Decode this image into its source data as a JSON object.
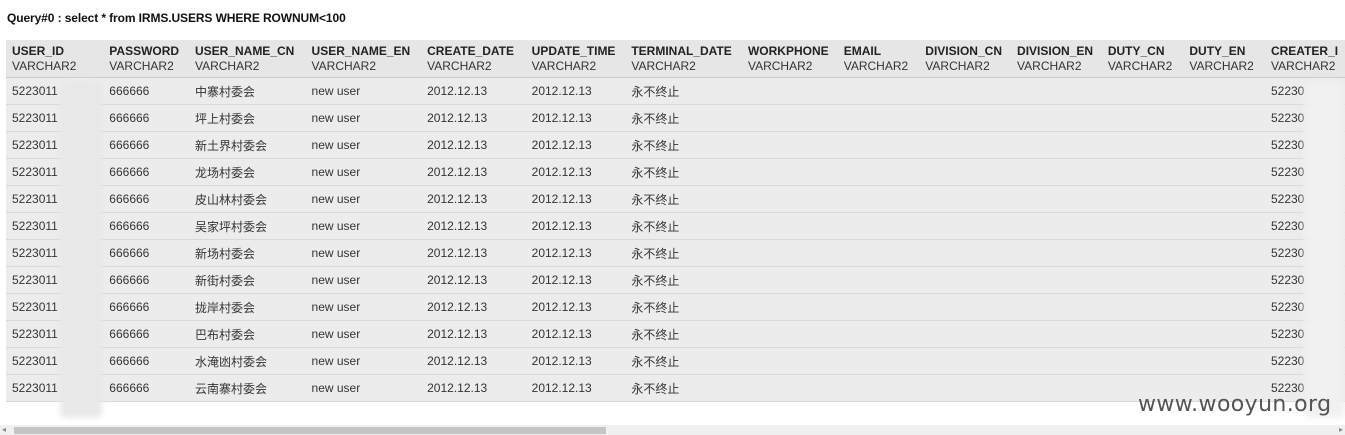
{
  "query": {
    "title": "Query#0 : select * from IRMS.USERS WHERE ROWNUM<100"
  },
  "columns": [
    {
      "name": "USER_ID",
      "type": "VARCHAR2"
    },
    {
      "name": "PASSWORD",
      "type": "VARCHAR2"
    },
    {
      "name": "USER_NAME_CN",
      "type": "VARCHAR2"
    },
    {
      "name": "USER_NAME_EN",
      "type": "VARCHAR2"
    },
    {
      "name": "CREATE_DATE",
      "type": "VARCHAR2"
    },
    {
      "name": "UPDATE_TIME",
      "type": "VARCHAR2"
    },
    {
      "name": "TERMINAL_DATE",
      "type": "VARCHAR2"
    },
    {
      "name": "WORKPHONE",
      "type": "VARCHAR2"
    },
    {
      "name": "EMAIL",
      "type": "VARCHAR2"
    },
    {
      "name": "DIVISION_CN",
      "type": "VARCHAR2"
    },
    {
      "name": "DIVISION_EN",
      "type": "VARCHAR2"
    },
    {
      "name": "DUTY_CN",
      "type": "VARCHAR2"
    },
    {
      "name": "DUTY_EN",
      "type": "VARCHAR2"
    },
    {
      "name": "CREATER_I",
      "type": "VARCHAR2"
    }
  ],
  "rows": [
    [
      "5223011",
      "666666",
      "中寨村委会",
      "new user",
      "2012.12.13",
      "2012.12.13",
      "永不终止",
      "",
      "",
      "",
      "",
      "",
      "",
      "52230"
    ],
    [
      "5223011",
      "666666",
      "坪上村委会",
      "new user",
      "2012.12.13",
      "2012.12.13",
      "永不终止",
      "",
      "",
      "",
      "",
      "",
      "",
      "52230"
    ],
    [
      "5223011",
      "666666",
      "新土界村委会",
      "new user",
      "2012.12.13",
      "2012.12.13",
      "永不终止",
      "",
      "",
      "",
      "",
      "",
      "",
      "52230"
    ],
    [
      "5223011",
      "666666",
      "龙场村委会",
      "new user",
      "2012.12.13",
      "2012.12.13",
      "永不终止",
      "",
      "",
      "",
      "",
      "",
      "",
      "52230"
    ],
    [
      "5223011",
      "666666",
      "皮山林村委会",
      "new user",
      "2012.12.13",
      "2012.12.13",
      "永不终止",
      "",
      "",
      "",
      "",
      "",
      "",
      "52230"
    ],
    [
      "5223011",
      "666666",
      "吴家坪村委会",
      "new user",
      "2012.12.13",
      "2012.12.13",
      "永不终止",
      "",
      "",
      "",
      "",
      "",
      "",
      "52230"
    ],
    [
      "5223011",
      "666666",
      "新场村委会",
      "new user",
      "2012.12.13",
      "2012.12.13",
      "永不终止",
      "",
      "",
      "",
      "",
      "",
      "",
      "52230"
    ],
    [
      "5223011",
      "666666",
      "新街村委会",
      "new user",
      "2012.12.13",
      "2012.12.13",
      "永不终止",
      "",
      "",
      "",
      "",
      "",
      "",
      "52230"
    ],
    [
      "5223011",
      "666666",
      "拢岸村委会",
      "new user",
      "2012.12.13",
      "2012.12.13",
      "永不终止",
      "",
      "",
      "",
      "",
      "",
      "",
      "52230"
    ],
    [
      "5223011",
      "666666",
      "巴布村委会",
      "new user",
      "2012.12.13",
      "2012.12.13",
      "永不终止",
      "",
      "",
      "",
      "",
      "",
      "",
      "52230"
    ],
    [
      "5223011",
      "666666",
      "水淹凼村委会",
      "new user",
      "2012.12.13",
      "2012.12.13",
      "永不终止",
      "",
      "",
      "",
      "",
      "",
      "",
      "52230"
    ],
    [
      "5223011",
      "666666",
      "云南寨村委会",
      "new user",
      "2012.12.13",
      "2012.12.13",
      "永不终止",
      "",
      "",
      "",
      "",
      "",
      "",
      "52230"
    ]
  ],
  "watermark": "www.wooyun.org",
  "scrollbar": {
    "left_arrow": "◂",
    "right_arrow": "▸"
  }
}
